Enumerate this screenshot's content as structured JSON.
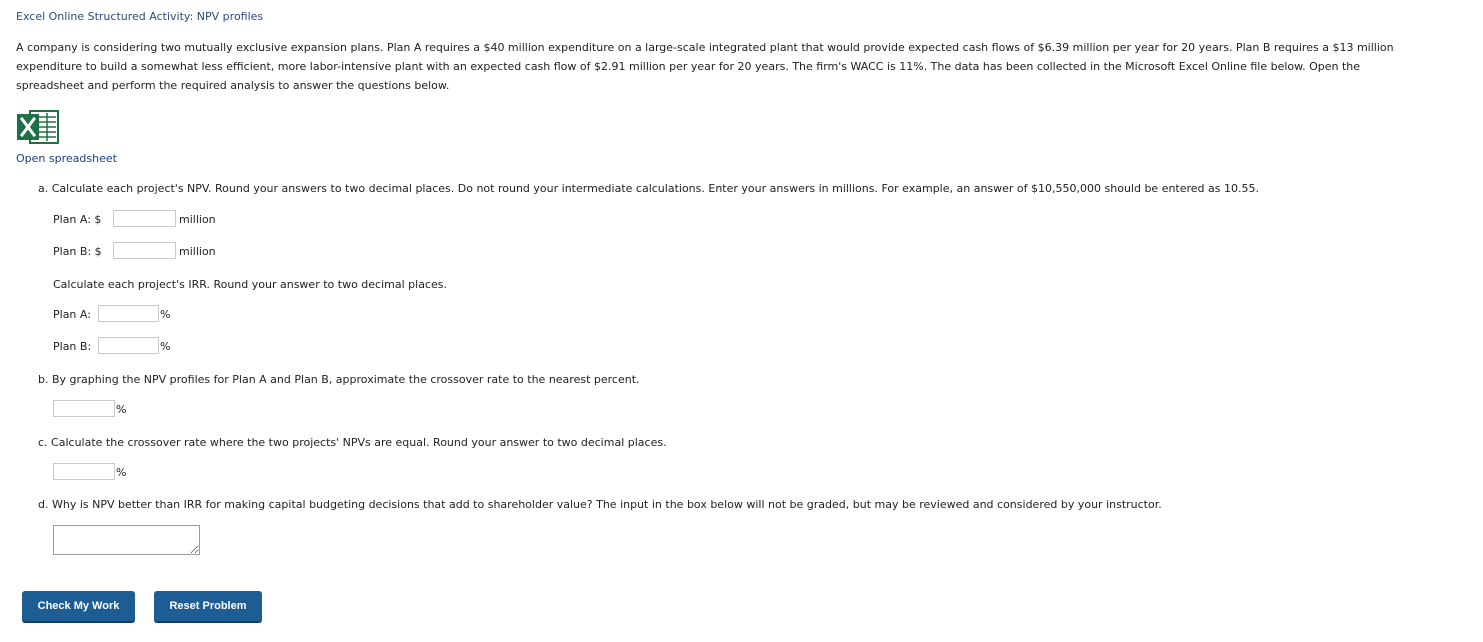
{
  "page": {
    "title": "Excel Online Structured Activity: NPV profiles",
    "intro_line1": "A company is considering two mutually exclusive expansion plans. Plan A requires a $40 million expenditure on a large-scale integrated plant that would provide expected cash flows of $6.39 million per year for 20 years. Plan B requires a $13 million",
    "intro_line2": "expenditure to build a somewhat less efficient, more labor-intensive plant with an expected cash flow of $2.91 million per year for 20 years. The firm's WACC is 11%. The data has been collected in the Microsoft Excel Online file below. Open the",
    "intro_line3": "spreadsheet and perform the required analysis to answer the questions below.",
    "excel_icon": "excel-icon",
    "open_spreadsheet": "Open spreadsheet"
  },
  "part_a": {
    "question": "a. Calculate each project's NPV. Round your answers to two decimal places. Do not round your intermediate calculations. Enter your answers in millions. For example, an answer of $10,550,000 should be entered as 10.55.",
    "plan_a_label": "Plan A: $",
    "plan_b_label": "Plan B: $",
    "npv_unit": "million",
    "npv_a_value": "",
    "npv_b_value": "",
    "irr_question": "Calculate each project's IRR. Round your answer to two decimal places.",
    "irr_a_label": "Plan A:",
    "irr_b_label": "Plan B:",
    "irr_unit": "%",
    "irr_a_value": "",
    "irr_b_value": ""
  },
  "part_b": {
    "question": "b. By graphing the NPV profiles for Plan A and Plan B, approximate the crossover rate to the nearest percent.",
    "unit": "%",
    "value": ""
  },
  "part_c": {
    "question": "c. Calculate the crossover rate where the two projects' NPVs are equal. Round your answer to two decimal places.",
    "unit": "%",
    "value": ""
  },
  "part_d": {
    "question": "d. Why is NPV better than IRR for making capital budgeting decisions that add to shareholder value? The input in the box below will not be graded, but may be reviewed and considered by your instructor.",
    "value": ""
  },
  "buttons": {
    "check": "Check My Work",
    "reset": "Reset Problem"
  },
  "colors": {
    "button_bg": "#1d5d94",
    "link": "#1a3d8f",
    "excel_green": "#1e7145"
  }
}
